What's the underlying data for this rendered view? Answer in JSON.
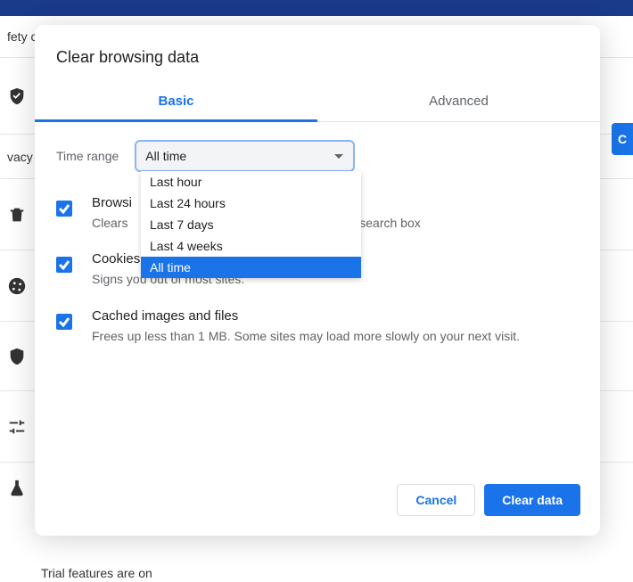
{
  "bg": {
    "row0": "fety c",
    "row1_icon": "shield-check",
    "row2": "vacy",
    "row3_icon": "trash",
    "row4_icon": "cookie",
    "row5_icon": "shield",
    "row6_icon": "sliders",
    "row7_icon": "flask",
    "button_fragment": "C",
    "bottom_text": "Trial features are on"
  },
  "modal": {
    "title": "Clear browsing data",
    "tabs": {
      "basic": "Basic",
      "advanced": "Advanced",
      "active": "basic"
    },
    "time_range_label": "Time range",
    "select": {
      "value": "All time",
      "options": [
        "Last hour",
        "Last 24 hours",
        "Last 7 days",
        "Last 4 weeks",
        "All time"
      ],
      "selected_index": 4
    },
    "items": [
      {
        "checked": true,
        "title": "Browsi",
        "desc_pre": "Clears",
        "desc_post": "search box"
      },
      {
        "checked": true,
        "title": "Cookies and other site data",
        "desc": "Signs you out of most sites."
      },
      {
        "checked": true,
        "title": "Cached images and files",
        "desc": "Frees up less than 1 MB. Some sites may load more slowly on your next visit."
      }
    ],
    "buttons": {
      "cancel": "Cancel",
      "confirm": "Clear data"
    }
  }
}
